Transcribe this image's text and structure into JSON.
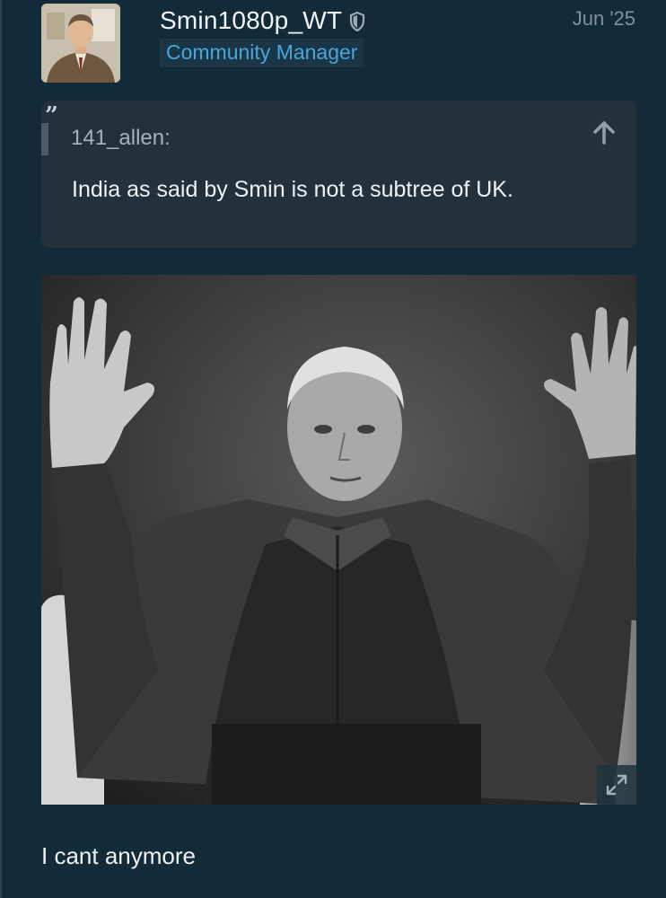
{
  "post": {
    "username": "Smin1080p_WT",
    "user_title": "Community Manager",
    "date": "Jun '25",
    "body": "I cant anymore"
  },
  "quote": {
    "author": "141_allen:",
    "text": "India as said by Smin is not a subtree of UK."
  },
  "icons": {
    "moderator": "shield-icon",
    "quote": "quote-icon",
    "jump_to_post": "arrow-up-icon",
    "expand_image": "expand-icon"
  },
  "colors": {
    "background": "#132a38",
    "quote_background": "#24313a",
    "accent": "#4aa6d8",
    "text": "#eef2f4",
    "muted": "#7f939f"
  }
}
